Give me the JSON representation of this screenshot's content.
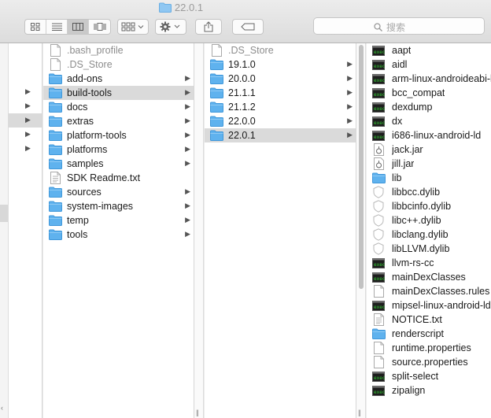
{
  "window": {
    "title": "22.0.1",
    "search_placeholder": "搜索"
  },
  "toolbar": {
    "views": [
      "icon-view-icon",
      "list-view-icon",
      "column-view-icon",
      "coverflow-view-icon"
    ],
    "active_view": "column-view-icon"
  },
  "columns": [
    {
      "items": [
        {
          "label": "",
          "arrow": true,
          "type": "folder"
        },
        {
          "label": "",
          "arrow": true,
          "type": "folder"
        },
        {
          "label": "",
          "arrow": true,
          "type": "folder",
          "selected": true
        },
        {
          "label": "",
          "arrow": true,
          "type": "folder"
        },
        {
          "label": "",
          "arrow": true,
          "type": "folder"
        }
      ]
    },
    {
      "items": [
        {
          "label": ".bash_profile",
          "type": "doc",
          "dim": true
        },
        {
          "label": ".DS_Store",
          "type": "doc",
          "dim": true
        },
        {
          "label": "add-ons",
          "type": "folder",
          "arrow": true
        },
        {
          "label": "build-tools",
          "type": "folder",
          "arrow": true,
          "selected": true
        },
        {
          "label": "docs",
          "type": "folder",
          "arrow": true
        },
        {
          "label": "extras",
          "type": "folder",
          "arrow": true
        },
        {
          "label": "platform-tools",
          "type": "folder",
          "arrow": true
        },
        {
          "label": "platforms",
          "type": "folder",
          "arrow": true
        },
        {
          "label": "samples",
          "type": "folder",
          "arrow": true
        },
        {
          "label": "SDK Readme.txt",
          "type": "txt"
        },
        {
          "label": "sources",
          "type": "folder",
          "arrow": true
        },
        {
          "label": "system-images",
          "type": "folder",
          "arrow": true
        },
        {
          "label": "temp",
          "type": "folder",
          "arrow": true
        },
        {
          "label": "tools",
          "type": "folder",
          "arrow": true
        }
      ]
    },
    {
      "items": [
        {
          "label": ".DS_Store",
          "type": "doc",
          "dim": true
        },
        {
          "label": "19.1.0",
          "type": "folder",
          "arrow": true
        },
        {
          "label": "20.0.0",
          "type": "folder",
          "arrow": true
        },
        {
          "label": "21.1.1",
          "type": "folder",
          "arrow": true
        },
        {
          "label": "21.1.2",
          "type": "folder",
          "arrow": true
        },
        {
          "label": "22.0.0",
          "type": "folder",
          "arrow": true
        },
        {
          "label": "22.0.1",
          "type": "folder",
          "arrow": true,
          "selected": true
        }
      ]
    },
    {
      "items": [
        {
          "label": "aapt",
          "type": "exec"
        },
        {
          "label": "aidl",
          "type": "exec"
        },
        {
          "label": "arm-linux-androideabi-ld",
          "type": "exec"
        },
        {
          "label": "bcc_compat",
          "type": "exec"
        },
        {
          "label": "dexdump",
          "type": "exec"
        },
        {
          "label": "dx",
          "type": "exec"
        },
        {
          "label": "i686-linux-android-ld",
          "type": "exec"
        },
        {
          "label": "jack.jar",
          "type": "jar"
        },
        {
          "label": "jill.jar",
          "type": "jar"
        },
        {
          "label": "lib",
          "type": "folder"
        },
        {
          "label": "libbcc.dylib",
          "type": "dylib"
        },
        {
          "label": "libbcinfo.dylib",
          "type": "dylib"
        },
        {
          "label": "libc++.dylib",
          "type": "dylib"
        },
        {
          "label": "libclang.dylib",
          "type": "dylib"
        },
        {
          "label": "libLLVM.dylib",
          "type": "dylib"
        },
        {
          "label": "llvm-rs-cc",
          "type": "exec"
        },
        {
          "label": "mainDexClasses",
          "type": "exec"
        },
        {
          "label": "mainDexClasses.rules",
          "type": "doc"
        },
        {
          "label": "mipsel-linux-android-ld",
          "type": "exec"
        },
        {
          "label": "NOTICE.txt",
          "type": "txt"
        },
        {
          "label": "renderscript",
          "type": "folder"
        },
        {
          "label": "runtime.properties",
          "type": "doc"
        },
        {
          "label": "source.properties",
          "type": "doc"
        },
        {
          "label": "split-select",
          "type": "exec"
        },
        {
          "label": "zipalign",
          "type": "exec"
        }
      ]
    }
  ],
  "colors": {
    "folder": "#5fb2ee",
    "folder_dark": "#3f97da",
    "selection": "#dadada",
    "exec": "#1e1e1e"
  }
}
